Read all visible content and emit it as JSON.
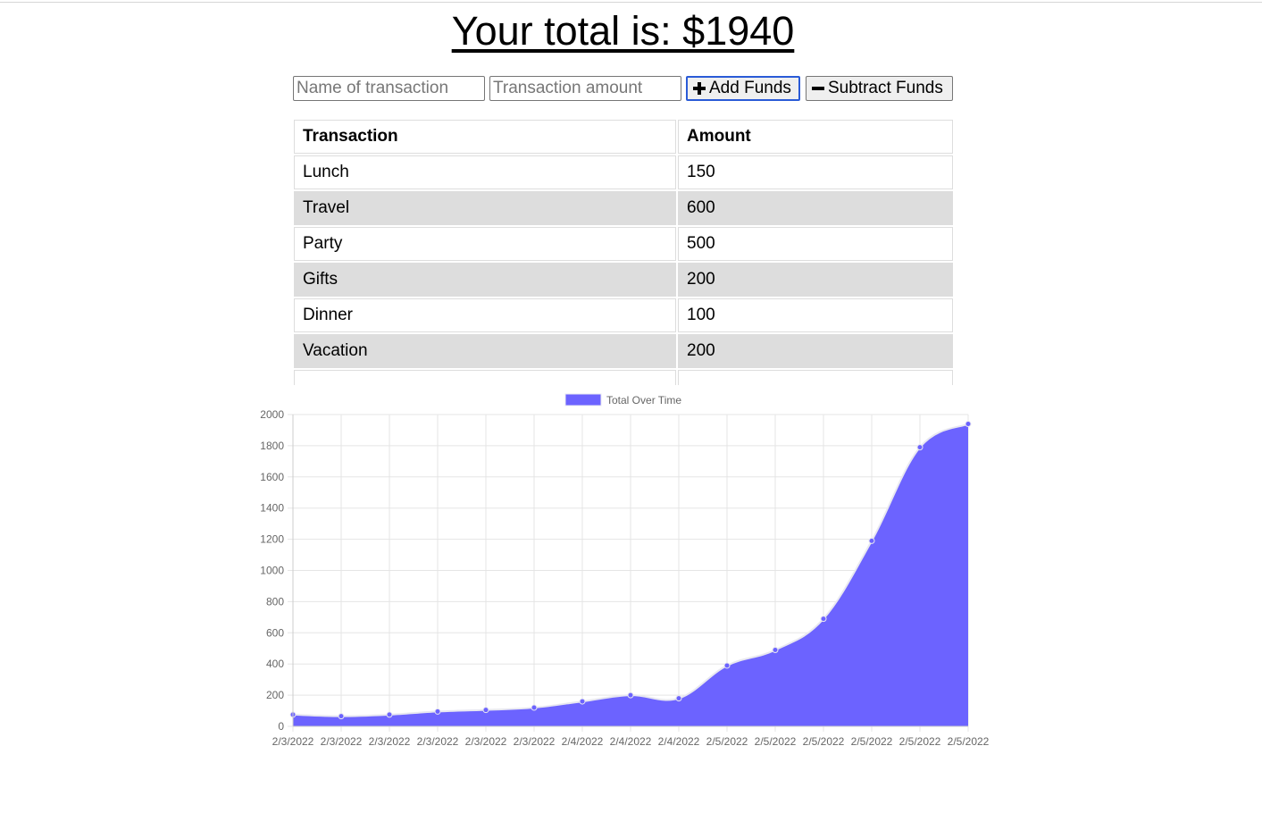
{
  "header": {
    "total_text": "Your total is: $1940"
  },
  "form": {
    "name_placeholder": "Name of transaction",
    "amount_placeholder": "Transaction amount",
    "add_label": "Add Funds",
    "subtract_label": "Subtract Funds"
  },
  "table": {
    "headers": [
      "Transaction",
      "Amount"
    ],
    "rows": [
      {
        "name": "Lunch",
        "amount": "150"
      },
      {
        "name": "Travel",
        "amount": "600"
      },
      {
        "name": "Party",
        "amount": "500"
      },
      {
        "name": "Gifts",
        "amount": "200"
      },
      {
        "name": "Dinner",
        "amount": "100"
      },
      {
        "name": "Vacation",
        "amount": "200"
      }
    ]
  },
  "colors": {
    "fill": "#6c63ff",
    "line": "#e8e8f0",
    "grid": "#e5e5e5",
    "row_alt": "#dddddd",
    "button_focus": "#2a5bd7"
  },
  "icons": {
    "add": "plus-icon",
    "subtract": "minus-icon"
  },
  "chart_data": {
    "type": "area",
    "legend": "Total Over Time",
    "x": [
      "2/3/2022",
      "2/3/2022",
      "2/3/2022",
      "2/3/2022",
      "2/3/2022",
      "2/3/2022",
      "2/4/2022",
      "2/4/2022",
      "2/4/2022",
      "2/5/2022",
      "2/5/2022",
      "2/5/2022",
      "2/5/2022",
      "2/5/2022",
      "2/5/2022"
    ],
    "series": [
      {
        "name": "Total Over Time",
        "values": [
          75,
          65,
          75,
          95,
          105,
          120,
          160,
          200,
          180,
          390,
          490,
          690,
          1190,
          1790,
          1940
        ]
      }
    ],
    "ylim": [
      0,
      2000
    ],
    "yticks": [
      0,
      200,
      400,
      600,
      800,
      1000,
      1200,
      1400,
      1600,
      1800,
      2000
    ],
    "grid": true,
    "legend_position": "top-center"
  }
}
